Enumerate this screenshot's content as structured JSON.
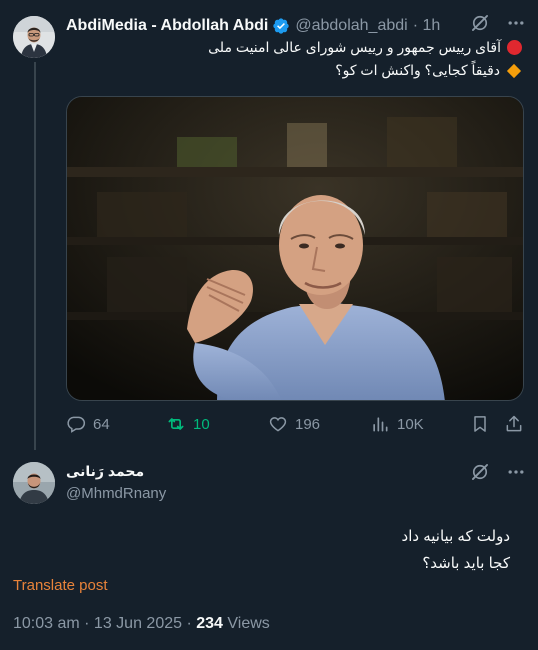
{
  "tweet": {
    "author_name": "AbdiMedia - Abdollah Abdi",
    "handle": "@abdolah_abdi",
    "time": "· 1h",
    "line1": "آقای رییس جمهور و رییس شورای عالی امنیت ملی",
    "line2": "دقیقاً کجایی؟ واکنش ات کو؟",
    "line1_icon": "red-circle",
    "line2_icon": "orange-diamond",
    "stats": {
      "replies": "64",
      "reposts": "10",
      "likes": "196",
      "views": "10K"
    }
  },
  "reply": {
    "author_name": "محمد رَنانی",
    "handle": "@MhmdRnany",
    "text_line1": "دولت که بیانیه داد",
    "text_line2": "کجا باید باشد؟",
    "translate": "Translate post",
    "timestamp": "10:03 am · 13 Jun 2025 · ",
    "views_count": "234",
    "views_label": " Views"
  },
  "colors": {
    "background": "#15202b",
    "secondary_text": "#8b98a5",
    "repost_green": "#00ba7c",
    "verified_blue": "#1d9bf0",
    "translate_orange": "#e8833a"
  }
}
